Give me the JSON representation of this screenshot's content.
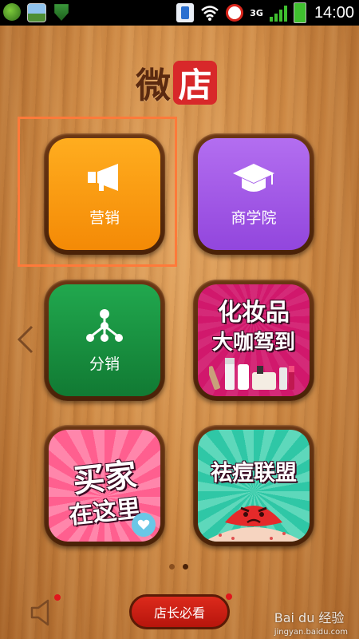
{
  "status_bar": {
    "time": "14:00",
    "network": "3G"
  },
  "logo": {
    "part1": "微",
    "part2": "店"
  },
  "tiles": [
    {
      "label": "营销",
      "icon": "megaphone-icon"
    },
    {
      "label": "商学院",
      "icon": "graduation-cap-icon"
    },
    {
      "label": "分销",
      "icon": "network-tree-icon"
    },
    {
      "label": "化妆品大咖驾到",
      "line1": "化妆品",
      "line2": "大咖驾到"
    },
    {
      "label": "买家在这里",
      "line1": "买家",
      "line2": "在这里"
    },
    {
      "label": "祛痘联盟"
    }
  ],
  "bottom": {
    "owner_button": "店长必看",
    "watermark": "Bai du 经验",
    "watermark_url": "jingyan.baidu.com"
  },
  "colors": {
    "marketing": "#f5920a",
    "academy": "#a15ae8",
    "distribution": "#19924a",
    "cosmetics": "#d1186c",
    "highlight_border": "#ff7a3a",
    "owner_button": "#cc1f14"
  }
}
